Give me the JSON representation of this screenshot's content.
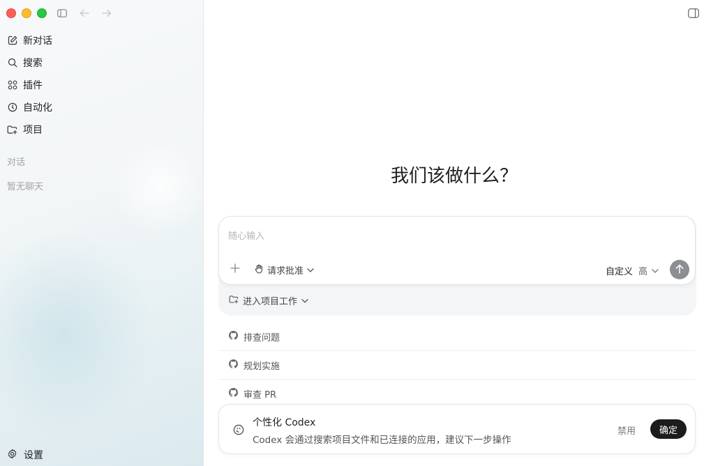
{
  "sidebar": {
    "nav": [
      {
        "label": "新对话",
        "icon": "edit-icon"
      },
      {
        "label": "搜索",
        "icon": "search-icon"
      },
      {
        "label": "插件",
        "icon": "grid-icon"
      },
      {
        "label": "自动化",
        "icon": "clock-icon"
      },
      {
        "label": "项目",
        "icon": "folder-icon"
      }
    ],
    "section_label": "对话",
    "empty_label": "暂无聊天",
    "settings_label": "设置"
  },
  "main": {
    "headline": "我们该做什么？",
    "composer": {
      "placeholder": "随心输入",
      "approval_label": "请求批准",
      "custom_label": "自定义",
      "level_label": "高"
    },
    "project_label": "进入项目工作",
    "suggestions": [
      {
        "label": "排查问题",
        "icon": "github-icon"
      },
      {
        "label": "规划实施",
        "icon": "github-icon"
      },
      {
        "label": "审查 PR",
        "icon": "github-icon"
      }
    ],
    "banner": {
      "title": "个性化 Codex",
      "description": "Codex 会通过搜索项目文件和已连接的应用，建议下一步操作",
      "disable_label": "禁用",
      "confirm_label": "确定"
    }
  },
  "colors": {
    "close": "#fe5f57",
    "minimize": "#febc2e",
    "zoom": "#28c840",
    "confirm_button": "#1c1c1e",
    "send_button": "#8c8f92"
  }
}
